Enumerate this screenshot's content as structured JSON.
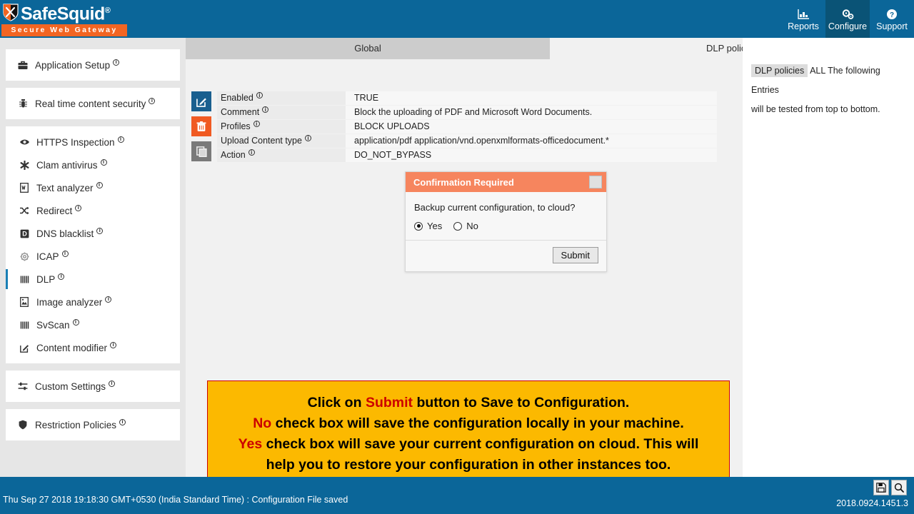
{
  "header": {
    "brand_name": "SafeSquid",
    "brand_reg": "®",
    "brand_tagline": "Secure Web Gateway",
    "nav": [
      {
        "label": "Reports",
        "icon": "chart-icon",
        "active": false
      },
      {
        "label": "Configure",
        "icon": "gears-icon",
        "active": true
      },
      {
        "label": "Support",
        "icon": "question-icon",
        "active": false
      }
    ]
  },
  "sidebar": {
    "groups": [
      {
        "items": [
          {
            "label": "Application Setup",
            "icon": "briefcase-icon",
            "badge": "i",
            "active": false
          }
        ]
      },
      {
        "items": [
          {
            "label": "Real time content security",
            "icon": "bug-shield-icon",
            "badge": "i",
            "active": false
          }
        ]
      },
      {
        "items": [
          {
            "label": "HTTPS Inspection",
            "icon": "eye-icon",
            "badge": "i",
            "active": false
          },
          {
            "label": "Clam antivirus",
            "icon": "asterisk-icon",
            "badge": "i",
            "active": false
          },
          {
            "label": "Text analyzer",
            "icon": "document-text-icon",
            "badge": "i",
            "active": false
          },
          {
            "label": "Redirect",
            "icon": "shuffle-icon",
            "badge": "i",
            "active": false
          },
          {
            "label": "DNS blacklist",
            "icon": "d-box-icon",
            "badge": "i",
            "active": false
          },
          {
            "label": "ICAP",
            "icon": "gear-outline-icon",
            "badge": "i",
            "active": false
          },
          {
            "label": "DLP",
            "icon": "bars-icon",
            "badge": "i",
            "active": true
          },
          {
            "label": "Image analyzer",
            "icon": "image-icon",
            "badge": "i",
            "active": false
          },
          {
            "label": "SvScan",
            "icon": "bars-icon",
            "badge": "i",
            "active": false
          },
          {
            "label": "Content modifier",
            "icon": "pencil-square-icon",
            "badge": "i",
            "active": false
          }
        ]
      },
      {
        "items": [
          {
            "label": "Custom Settings",
            "icon": "sliders-icon",
            "badge": "i",
            "active": false
          }
        ]
      },
      {
        "items": [
          {
            "label": "Restriction Policies",
            "icon": "shield-icon",
            "badge": "i",
            "active": false
          }
        ]
      }
    ]
  },
  "main": {
    "tabs": [
      {
        "label": "Global",
        "active": true
      },
      {
        "label": "DLP policies",
        "active": false
      }
    ],
    "row_tools": [
      {
        "name": "edit-entry-button",
        "icon": "pencil-square-icon"
      },
      {
        "name": "delete-entry-button",
        "icon": "trash-icon"
      },
      {
        "name": "copy-entry-button",
        "icon": "copy-icon"
      }
    ],
    "sort_tools": [
      {
        "name": "move-to-top-button",
        "icon": "arrow-up-circle-icon"
      },
      {
        "name": "move-up-button",
        "icon": "triangle-up-icon"
      },
      {
        "name": "move-down-button",
        "icon": "triangle-down-icon"
      },
      {
        "name": "move-to-bottom-button",
        "icon": "arrow-down-circle-icon"
      }
    ],
    "fields": [
      {
        "label": "Enabled",
        "badge": "i",
        "value": "TRUE"
      },
      {
        "label": "Comment",
        "badge": "i",
        "value": "Block the uploading of PDF and Microsoft Word Documents."
      },
      {
        "label": "Profiles",
        "badge": "i",
        "value": "BLOCK UPLOADS"
      },
      {
        "label": "Upload Content type",
        "badge": "i",
        "value": "application/pdf  application/vnd.openxmlformats-officedocument.*"
      },
      {
        "label": "Action",
        "badge": "i",
        "value": "DO_NOT_BYPASS"
      }
    ],
    "add_button_label": "+"
  },
  "dialog": {
    "title": "Confirmation Required",
    "question": "Backup current configuration, to cloud?",
    "options": [
      {
        "label": "Yes",
        "selected": true
      },
      {
        "label": "No",
        "selected": false
      }
    ],
    "submit_label": "Submit"
  },
  "banner": {
    "lines": [
      {
        "parts": [
          {
            "text": "Click on ",
            "red": false
          },
          {
            "text": "Submit",
            "red": true
          },
          {
            "text": " button to Save to Configuration.",
            "red": false
          }
        ]
      },
      {
        "parts": [
          {
            "text": "No",
            "red": true
          },
          {
            "text": " check box will save the configuration locally in your machine.",
            "red": false
          }
        ]
      },
      {
        "parts": [
          {
            "text": "Yes",
            "red": true
          },
          {
            "text": " check box will save your current configuration on cloud. This will",
            "red": false
          }
        ]
      },
      {
        "parts": [
          {
            "text": "help you to restore your configuration in other instances too.",
            "red": false
          }
        ]
      }
    ]
  },
  "info_panel": {
    "chip": "DLP policies",
    "text_after_chip": "ALL The following Entries",
    "text_line2": "will be tested from top to bottom."
  },
  "footer": {
    "status": "Thu Sep 27 2018 19:18:30 GMT+0530 (India Standard Time) : Configuration File saved",
    "version": "2018.0924.1451.3",
    "buttons": [
      {
        "name": "save-config-button",
        "icon": "floppy-disk-icon"
      },
      {
        "name": "search-button",
        "icon": "magnifier-icon"
      }
    ]
  },
  "colors": {
    "header_blue": "#0b6699",
    "accent_orange": "#f05a22",
    "dialog_orange": "#f6855e",
    "banner_yellow": "#fcb900",
    "banner_red": "#cc0000",
    "active_tab_gray": "#cccccc"
  }
}
